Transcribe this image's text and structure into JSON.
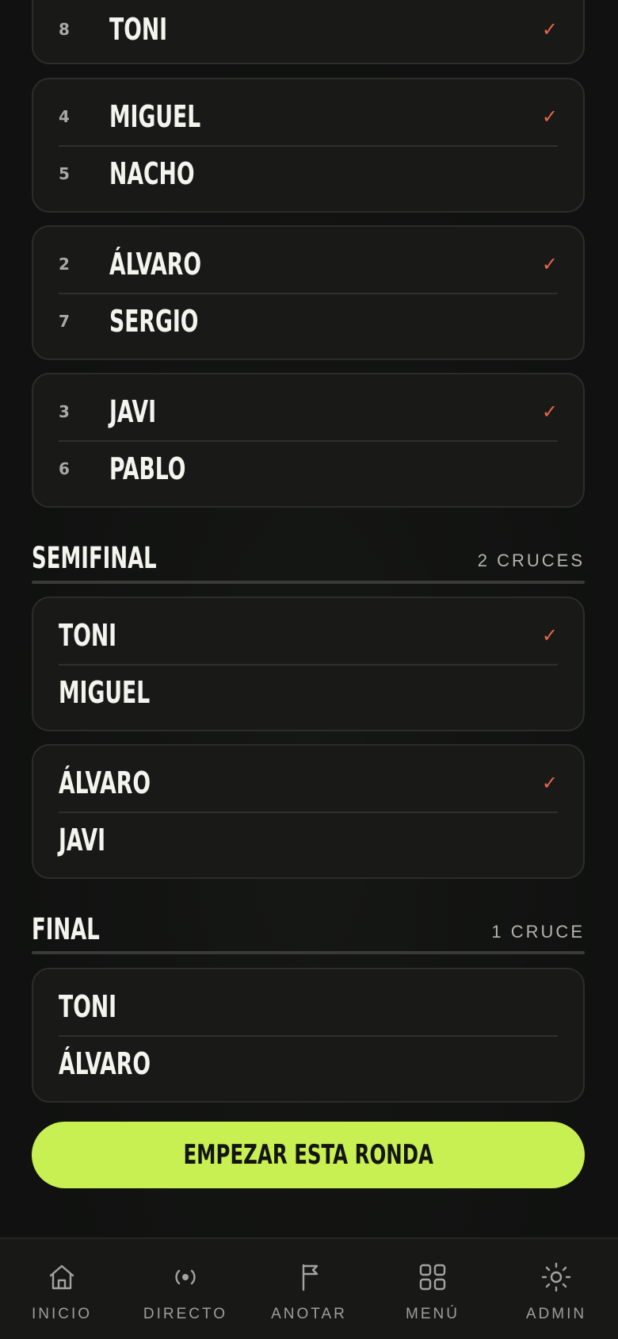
{
  "rounds": [
    {
      "matches": [
        {
          "players": [
            {
              "seed": "8",
              "name": "TONI",
              "winner": true
            }
          ]
        },
        {
          "players": [
            {
              "seed": "4",
              "name": "MIGUEL",
              "winner": true
            },
            {
              "seed": "5",
              "name": "NACHO",
              "winner": false
            }
          ]
        },
        {
          "players": [
            {
              "seed": "2",
              "name": "ÁLVARO",
              "winner": true
            },
            {
              "seed": "7",
              "name": "SERGIO",
              "winner": false
            }
          ]
        },
        {
          "players": [
            {
              "seed": "3",
              "name": "JAVI",
              "winner": true
            },
            {
              "seed": "6",
              "name": "PABLO",
              "winner": false
            }
          ]
        }
      ]
    },
    {
      "title": "SEMIFINAL",
      "count": "2 CRUCES",
      "matches": [
        {
          "players": [
            {
              "name": "TONI",
              "winner": true
            },
            {
              "name": "MIGUEL",
              "winner": false
            }
          ]
        },
        {
          "players": [
            {
              "name": "ÁLVARO",
              "winner": true
            },
            {
              "name": "JAVI",
              "winner": false
            }
          ]
        }
      ]
    },
    {
      "title": "FINAL",
      "count": "1 CRUCE",
      "matches": [
        {
          "players": [
            {
              "name": "TONI",
              "winner": false
            },
            {
              "name": "ÁLVARO",
              "winner": false
            }
          ]
        }
      ]
    }
  ],
  "check_glyph": "✓",
  "cta": {
    "label": "EMPEZAR ESTA RONDA"
  },
  "tabs": [
    {
      "label": "INICIO",
      "icon": "home-icon"
    },
    {
      "label": "DIRECTO",
      "icon": "live-icon"
    },
    {
      "label": "ANOTAR",
      "icon": "flag-icon"
    },
    {
      "label": "MENÚ",
      "icon": "grid-icon"
    },
    {
      "label": "ADMIN",
      "icon": "sun-icon"
    }
  ],
  "colors": {
    "accent": "#c8f052",
    "check": "#e8664a",
    "background": "#121311"
  }
}
